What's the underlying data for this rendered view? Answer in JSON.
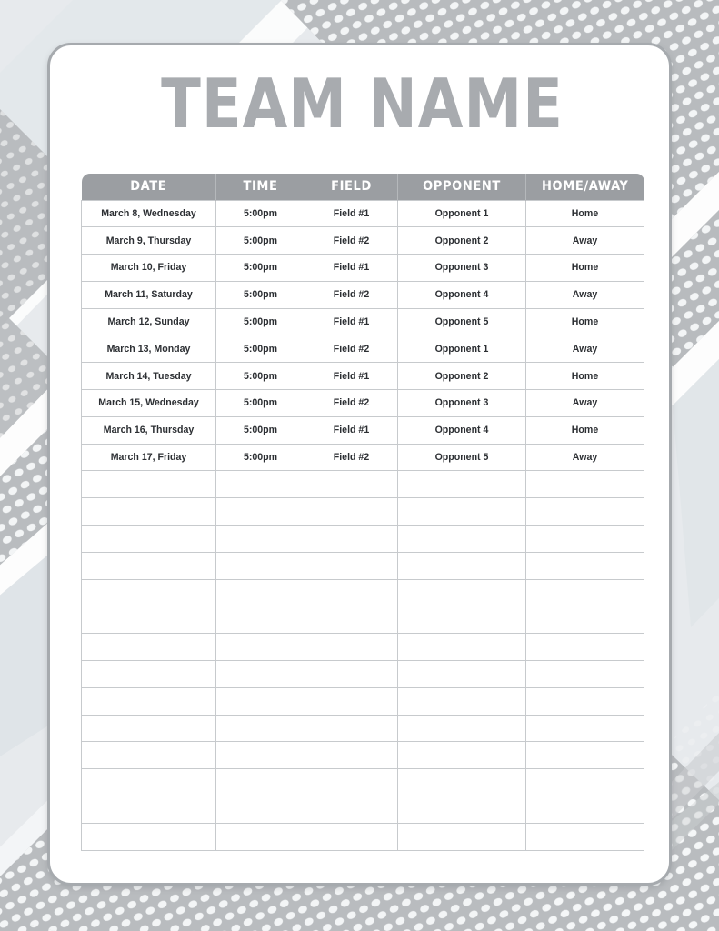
{
  "page": {
    "title": "TEAM NAME",
    "background_style": "diagonal-halftone-dot-bands",
    "colors": {
      "title_gray": "#a8abaf",
      "header_gray": "#9b9ea2",
      "card_border": "#a6aaae",
      "grid_line": "#c7cacd",
      "cell_text": "#2c2f33",
      "page_bg": "#e9ecef",
      "band_gray": "#b9bcbf",
      "band_light": "#dfe3e6",
      "dot_white": "#f2f4f5"
    }
  },
  "table": {
    "columns": [
      {
        "key": "date",
        "label": "DATE"
      },
      {
        "key": "time",
        "label": "TIME"
      },
      {
        "key": "field",
        "label": "FIELD"
      },
      {
        "key": "opponent",
        "label": "OPPONENT"
      },
      {
        "key": "homeaway",
        "label": "HOME/AWAY"
      }
    ],
    "total_rows": 24,
    "filled_row_count": 10,
    "blank_row_count": 14,
    "rows": [
      {
        "date": "March 8, Wednesday",
        "time": "5:00pm",
        "field": "Field #1",
        "opponent": "Opponent 1",
        "homeaway": "Home"
      },
      {
        "date": "March 9, Thursday",
        "time": "5:00pm",
        "field": "Field #2",
        "opponent": "Opponent 2",
        "homeaway": "Away"
      },
      {
        "date": "March 10, Friday",
        "time": "5:00pm",
        "field": "Field #1",
        "opponent": "Opponent 3",
        "homeaway": "Home"
      },
      {
        "date": "March 11, Saturday",
        "time": "5:00pm",
        "field": "Field #2",
        "opponent": "Opponent 4",
        "homeaway": "Away"
      },
      {
        "date": "March 12, Sunday",
        "time": "5:00pm",
        "field": "Field #1",
        "opponent": "Opponent 5",
        "homeaway": "Home"
      },
      {
        "date": "March 13, Monday",
        "time": "5:00pm",
        "field": "Field #2",
        "opponent": "Opponent 1",
        "homeaway": "Away"
      },
      {
        "date": "March 14, Tuesday",
        "time": "5:00pm",
        "field": "Field #1",
        "opponent": "Opponent 2",
        "homeaway": "Home"
      },
      {
        "date": "March 15, Wednesday",
        "time": "5:00pm",
        "field": "Field #2",
        "opponent": "Opponent 3",
        "homeaway": "Away"
      },
      {
        "date": "March 16, Thursday",
        "time": "5:00pm",
        "field": "Field #1",
        "opponent": "Opponent 4",
        "homeaway": "Home"
      },
      {
        "date": "March 17, Friday",
        "time": "5:00pm",
        "field": "Field #2",
        "opponent": "Opponent 5",
        "homeaway": "Away"
      },
      {
        "date": "",
        "time": "",
        "field": "",
        "opponent": "",
        "homeaway": ""
      },
      {
        "date": "",
        "time": "",
        "field": "",
        "opponent": "",
        "homeaway": ""
      },
      {
        "date": "",
        "time": "",
        "field": "",
        "opponent": "",
        "homeaway": ""
      },
      {
        "date": "",
        "time": "",
        "field": "",
        "opponent": "",
        "homeaway": ""
      },
      {
        "date": "",
        "time": "",
        "field": "",
        "opponent": "",
        "homeaway": ""
      },
      {
        "date": "",
        "time": "",
        "field": "",
        "opponent": "",
        "homeaway": ""
      },
      {
        "date": "",
        "time": "",
        "field": "",
        "opponent": "",
        "homeaway": ""
      },
      {
        "date": "",
        "time": "",
        "field": "",
        "opponent": "",
        "homeaway": ""
      },
      {
        "date": "",
        "time": "",
        "field": "",
        "opponent": "",
        "homeaway": ""
      },
      {
        "date": "",
        "time": "",
        "field": "",
        "opponent": "",
        "homeaway": ""
      },
      {
        "date": "",
        "time": "",
        "field": "",
        "opponent": "",
        "homeaway": ""
      },
      {
        "date": "",
        "time": "",
        "field": "",
        "opponent": "",
        "homeaway": ""
      },
      {
        "date": "",
        "time": "",
        "field": "",
        "opponent": "",
        "homeaway": ""
      },
      {
        "date": "",
        "time": "",
        "field": "",
        "opponent": "",
        "homeaway": ""
      }
    ]
  }
}
